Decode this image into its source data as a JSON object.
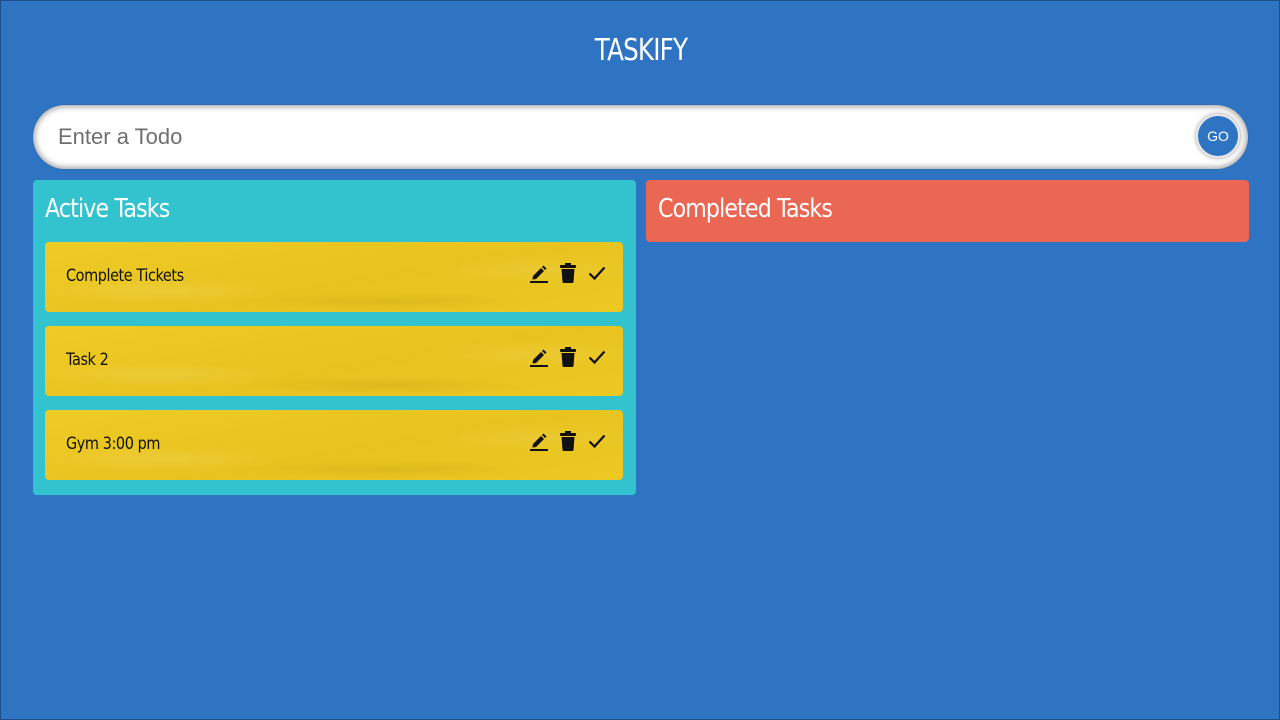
{
  "app": {
    "title": "TASKIFY"
  },
  "input": {
    "placeholder": "Enter a Todo",
    "value": "",
    "go_label": "GO"
  },
  "active": {
    "heading": "Active Tasks",
    "tasks": [
      {
        "text": "Complete Tickets"
      },
      {
        "text": "Task 2"
      },
      {
        "text": "Gym 3:00 pm"
      }
    ]
  },
  "completed": {
    "heading": "Completed Tasks",
    "tasks": []
  },
  "colors": {
    "background": "#2f74c3",
    "active_panel": "#32c3cf",
    "completed_panel": "#ea6753",
    "task_card": "#eac720"
  },
  "icons": {
    "edit": "pencil-icon",
    "delete": "trash-icon",
    "done": "checkmark-icon"
  }
}
